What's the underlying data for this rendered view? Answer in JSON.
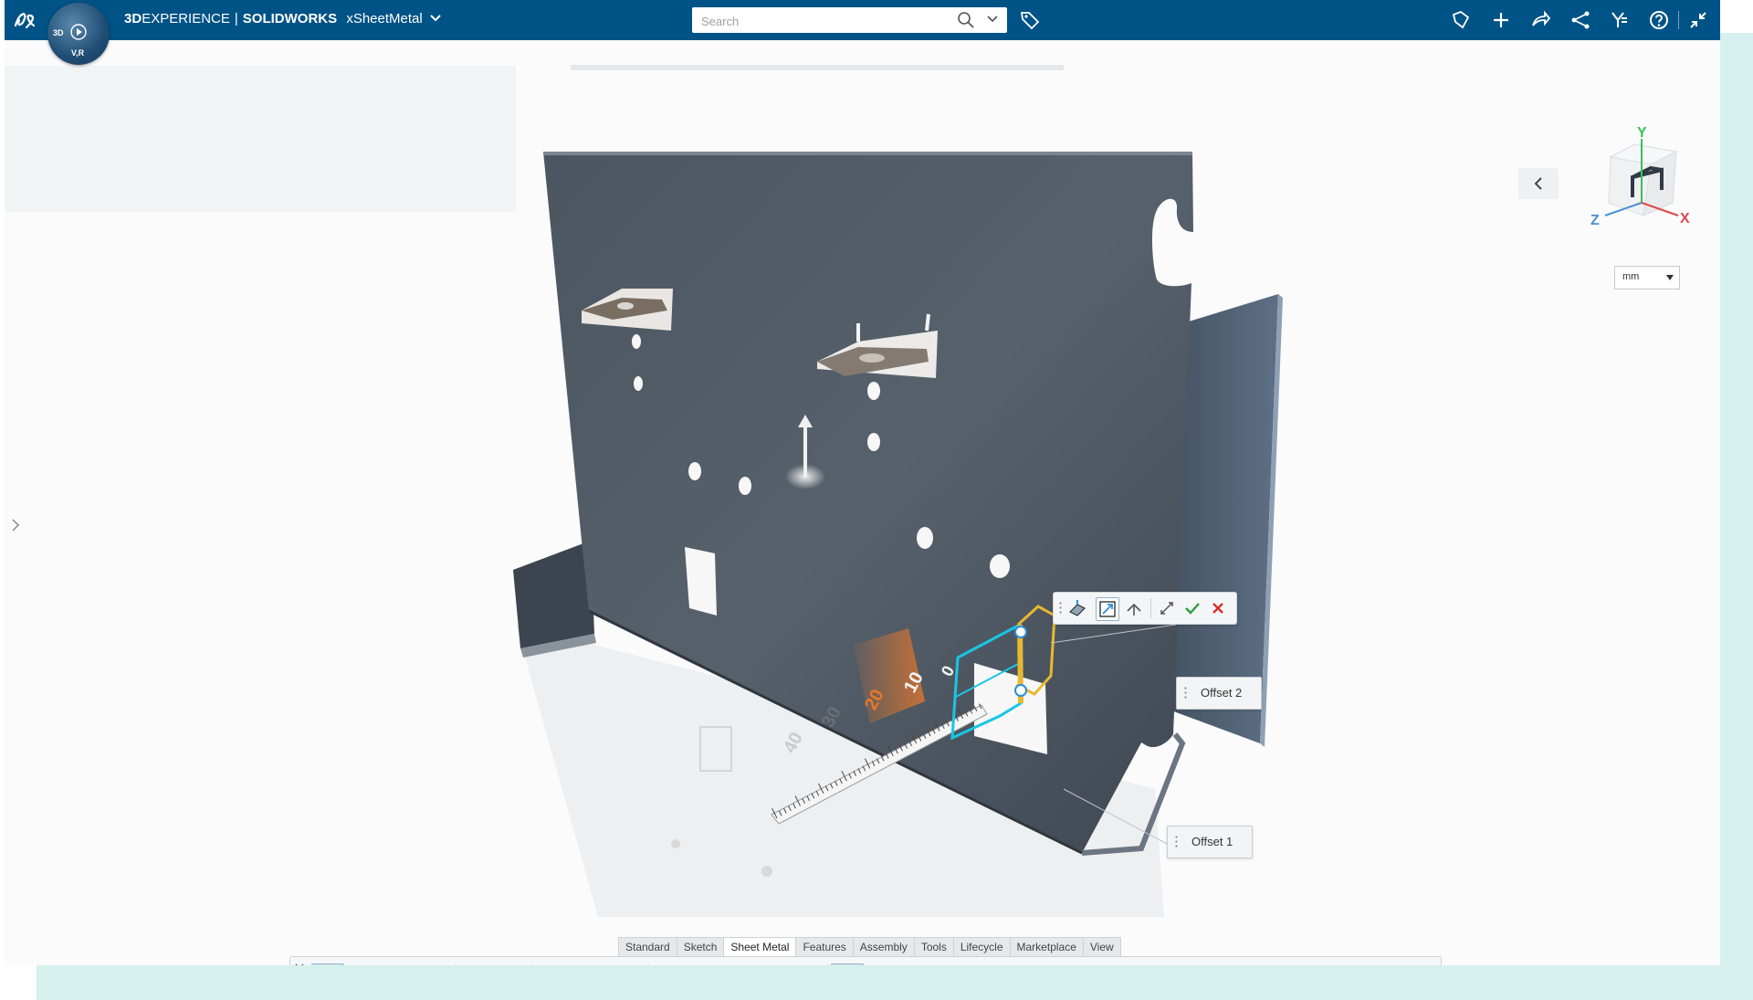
{
  "app": {
    "brand_prefix": "3D",
    "brand_experience": "EXPERIENCE",
    "separator": "|",
    "product": "SOLIDWORKS",
    "app_name": "xSheetMetal"
  },
  "compass": {
    "label_3d": "3D",
    "label_vr": "V,R"
  },
  "search": {
    "placeholder": "Search"
  },
  "viewcube": {
    "axis_x": "X",
    "axis_y": "Y",
    "axis_z": "Z"
  },
  "units": {
    "selected": "mm"
  },
  "ruler": {
    "tick_0": "0",
    "tick_10": "10",
    "tick_20": "20",
    "tick_30": "30",
    "tick_40": "40"
  },
  "offset_labels": {
    "offset2": "Offset 2",
    "offset1": "Offset 1"
  },
  "tabs": [
    {
      "label": "Standard"
    },
    {
      "label": "Sketch"
    },
    {
      "label": "Sheet Metal"
    },
    {
      "label": "Features"
    },
    {
      "label": "Assembly"
    },
    {
      "label": "Tools"
    },
    {
      "label": "Lifecycle"
    },
    {
      "label": "Marketplace"
    },
    {
      "label": "View"
    }
  ],
  "active_tab": "Sheet Metal",
  "colors": {
    "topbar": "#005386",
    "accent_bg": "#d6f0ee",
    "plate": "#4a5560",
    "ruler_orange": "#e8782a",
    "selection_cyan": "#19c6e6",
    "handle_yellow": "#e8b830",
    "confirm_green": "#2e9e3a",
    "cancel_red": "#d3312b"
  }
}
